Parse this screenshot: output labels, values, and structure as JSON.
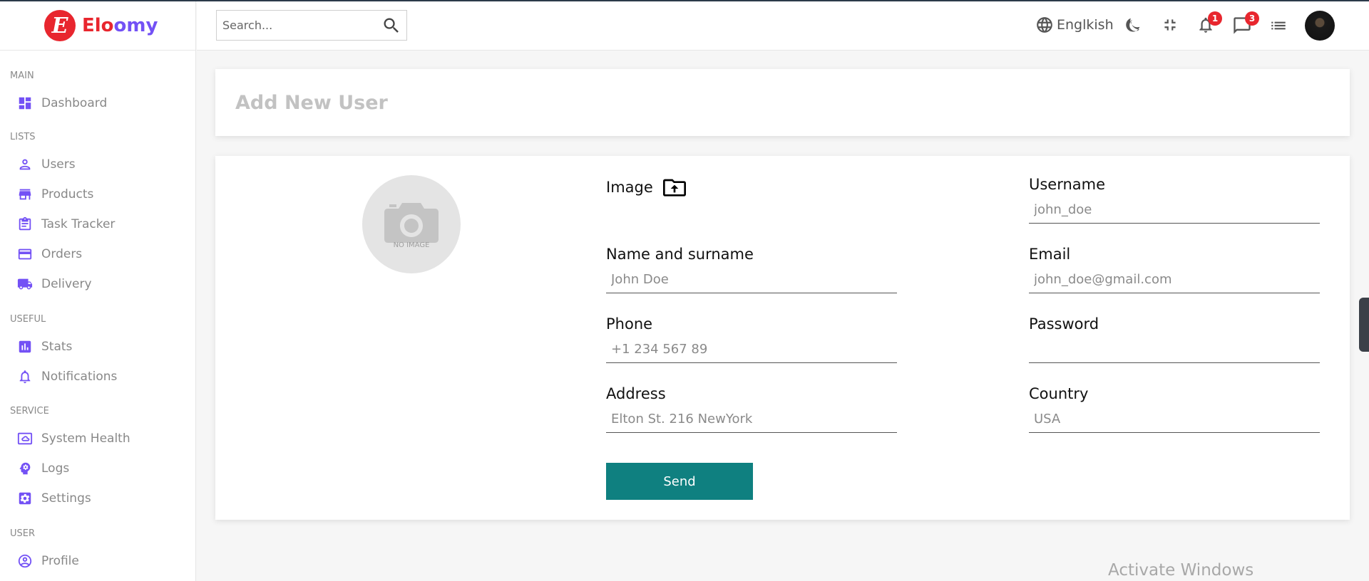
{
  "app": {
    "logo_letter": "E",
    "logo_part1": "Elo",
    "logo_part2": "omy"
  },
  "sidebar": {
    "sections": [
      {
        "title": "MAIN",
        "items": [
          {
            "label": "Dashboard",
            "icon": "dashboard-icon"
          }
        ]
      },
      {
        "title": "LISTS",
        "items": [
          {
            "label": "Users",
            "icon": "user-icon"
          },
          {
            "label": "Products",
            "icon": "store-icon"
          },
          {
            "label": "Task Tracker",
            "icon": "clipboard-icon"
          },
          {
            "label": "Orders",
            "icon": "credit-card-icon"
          },
          {
            "label": "Delivery",
            "icon": "truck-icon"
          }
        ]
      },
      {
        "title": "USEFUL",
        "items": [
          {
            "label": "Stats",
            "icon": "bar-chart-icon"
          },
          {
            "label": "Notifications",
            "icon": "bell-icon"
          }
        ]
      },
      {
        "title": "SERVICE",
        "items": [
          {
            "label": "System Health",
            "icon": "cloud-icon"
          },
          {
            "label": "Logs",
            "icon": "brain-icon"
          },
          {
            "label": "Settings",
            "icon": "settings-icon"
          }
        ]
      },
      {
        "title": "USER",
        "items": [
          {
            "label": "Profile",
            "icon": "profile-icon"
          }
        ]
      }
    ]
  },
  "topbar": {
    "search_placeholder": "Search...",
    "language": "Englkish",
    "notifications_count": "1",
    "messages_count": "3"
  },
  "page": {
    "title": "Add New User"
  },
  "form": {
    "no_image_caption": "NO IMAGE",
    "image_label": "Image",
    "fields": {
      "username": {
        "label": "Username",
        "placeholder": "john_doe"
      },
      "name": {
        "label": "Name and surname",
        "placeholder": "John Doe"
      },
      "email": {
        "label": "Email",
        "placeholder": "john_doe@gmail.com"
      },
      "phone": {
        "label": "Phone",
        "placeholder": "+1 234 567 89"
      },
      "password": {
        "label": "Password",
        "placeholder": ""
      },
      "address": {
        "label": "Address",
        "placeholder": "Elton St. 216 NewYork"
      },
      "country": {
        "label": "Country",
        "placeholder": "USA"
      }
    },
    "send_label": "Send"
  },
  "watermark": "Activate Windows",
  "colors": {
    "accent": "#7351f5",
    "brand_red": "#e8262e",
    "button": "#0f8080"
  }
}
